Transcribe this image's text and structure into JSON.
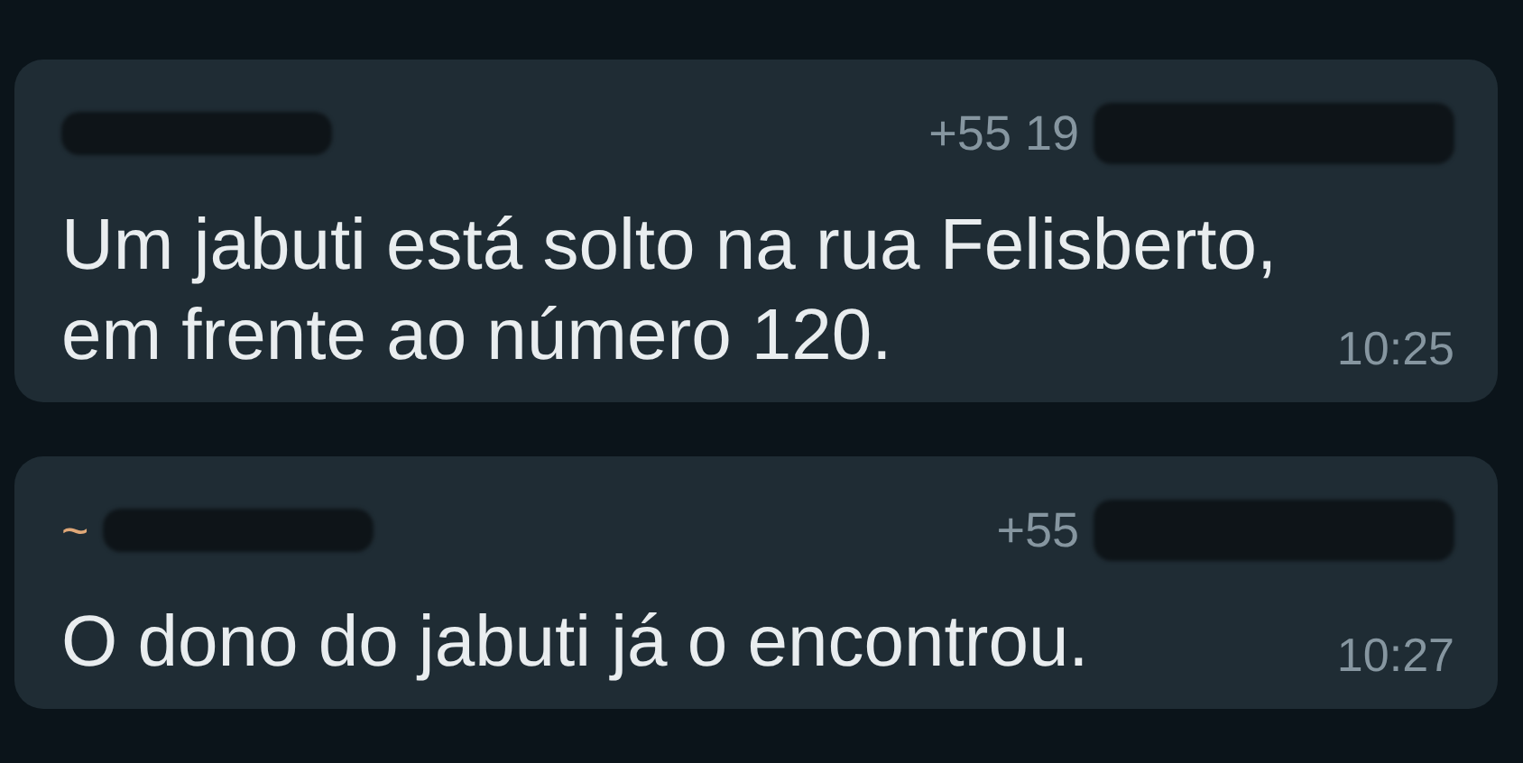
{
  "messages": [
    {
      "phone": "+55 19",
      "redacted": true,
      "text": "Um jabuti está solto na rua Felisberto, em frente ao número 120.",
      "time": "10:25"
    },
    {
      "sender": "~",
      "phone": "+55",
      "redacted": true,
      "text": "O dono do jabuti já o encontrou.",
      "time": "10:27"
    }
  ]
}
